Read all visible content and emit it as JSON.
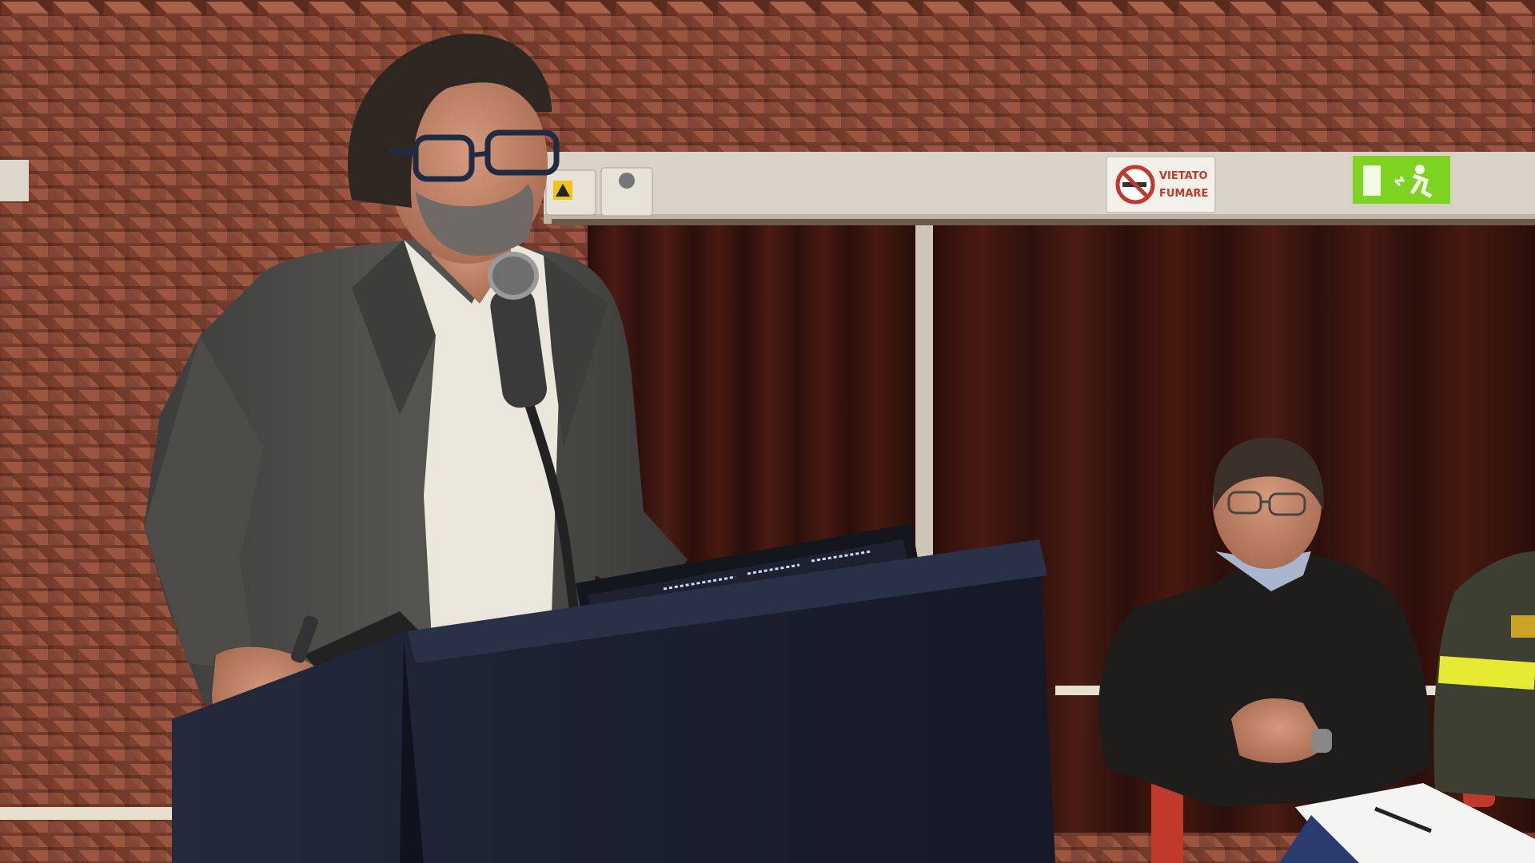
{
  "scene": {
    "no_smoking_sign": {
      "line1": "VIETATO",
      "line2": "FUMARE"
    },
    "icons": [
      "no-smoking-icon",
      "emergency-exit-icon",
      "warning-triangle-icon"
    ],
    "colors": {
      "brick_wall": "#8a4a38",
      "curtain": "#3a1410",
      "podium": "#1c1f2e",
      "exit_sign": "#7ed321",
      "jacket": "#4a4a4a",
      "shirt": "#ede8df"
    }
  }
}
